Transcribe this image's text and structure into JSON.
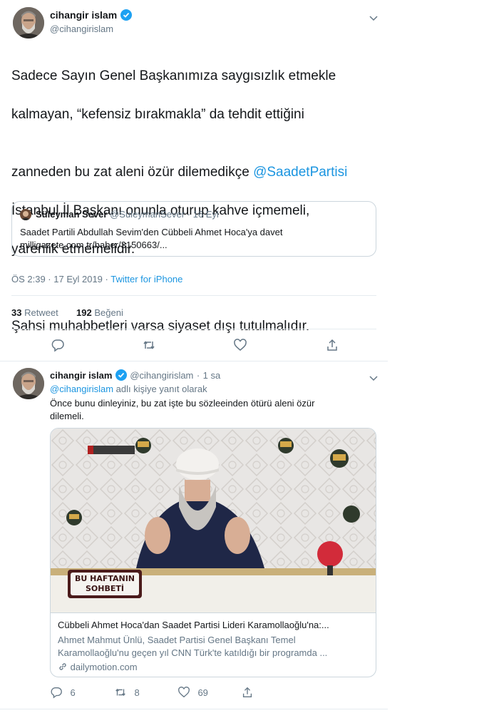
{
  "tweet1": {
    "author_name": "cihangir islam",
    "author_handle": "@cihangirislam",
    "body": {
      "line1": "Sadece Sayın Genel Başkanımıza saygısızlık etmekle",
      "line2": "kalmayan, “kefensiz bırakmakla” da tehdit ettiğini",
      "line3_pre": "zanneden bu zat aleni özür dilemedikçe ",
      "line3_mention": "@SaadetPartisi",
      "line4": "İstanbul İl Başkanı onunla oturup kahve içmemeli,",
      "line5": "yarenlik etmemelidir.",
      "line6": "Şahsi muhabbetleri varsa siyaset dışı tutulmalıdır."
    },
    "quote": {
      "name": "Süleyman Sever",
      "handle": "@SuleymanSever",
      "sep": "·",
      "date": "16 Eyl",
      "text": "Saadet Partili Abdullah Sevim'den Cübbeli Ahmet Hoca'ya davet",
      "link": "milligazete.com.tr/haber/3150663/..."
    },
    "timestamp": "ÖS 2:39 · 17 Eyl 2019 · ",
    "source": "Twitter for iPhone",
    "retweets": "33",
    "retweets_label": "Retweet",
    "likes": "192",
    "likes_label": "Beğeni"
  },
  "tweet2": {
    "author_name": "cihangir islam",
    "author_handle": "@cihangirislam",
    "sep": "·",
    "time": "1 sa",
    "reply_mention": "@cihangirislam",
    "reply_suffix": " adlı kişiye yanıt olarak",
    "body_line1": "Önce bunu dinleyiniz, bu zat işte bu sözleeinden ötürü aleni özür",
    "body_line2": "dilemeli.",
    "video_overlay_line1": "BU HAFTANIN",
    "video_overlay_line2": "SOHBETİ",
    "card_title": "Cübbeli Ahmet Hoca'dan Saadet Partisi Lideri Karamollaoğlu'na:...",
    "card_desc1": "Ahmet Mahmut Ünlü, Saadet Partisi Genel Başkanı Temel",
    "card_desc2": "Karamollaoğlu'nu geçen yıl CNN Türk'te katıldığı bir programda ...",
    "card_domain": "dailymotion.com",
    "replies": "6",
    "retweets": "8",
    "likes": "69"
  },
  "colors": {
    "link": "#1b95e0",
    "secondary": "#657786",
    "border": "#ccd6dd",
    "text": "#14171a"
  }
}
